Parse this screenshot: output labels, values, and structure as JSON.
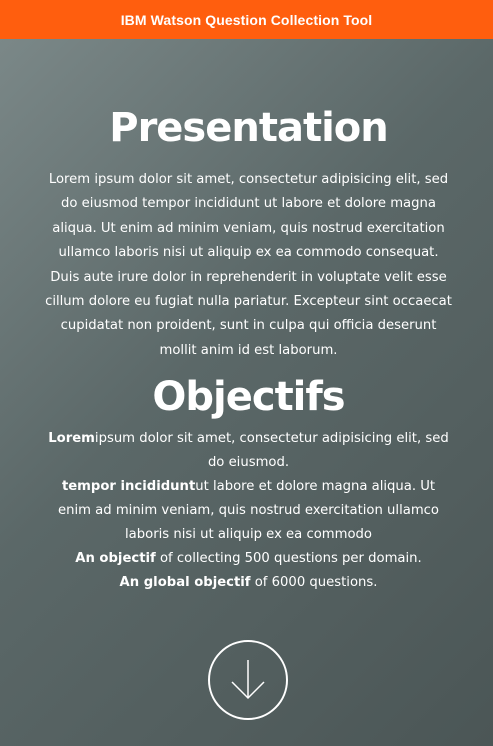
{
  "header": {
    "title": "IBM Watson Question Collection Tool"
  },
  "presentation": {
    "heading": "Presentation",
    "text": "Lorem ipsum dolor sit amet, consectetur adipisicing elit, sed do eiusmod tempor incididunt ut labore et dolore magna aliqua. Ut enim ad minim veniam, quis nostrud exercitation ullamco laboris nisi ut aliquip ex ea commodo consequat. Duis aute irure dolor in reprehenderit in voluptate velit esse cillum dolore eu fugiat nulla pariatur. Excepteur sint occaecat cupidatat non proident, sunt in culpa qui officia deserunt mollit anim id est laborum."
  },
  "objectifs": {
    "heading": "Objectifs",
    "line1_bold": "Lorem",
    "line1_text": "ipsum dolor sit amet, consectetur adipisicing elit, sed do eiusmod.",
    "line2_bold": "tempor incididunt",
    "line2_text": "ut labore et dolore magna aliqua. Ut enim ad minim veniam, quis nostrud exercitation ullamco laboris nisi ut aliquip ex ea commodo",
    "line3_bold": "An objectif",
    "line3_text": " of collecting 500 questions per domain.",
    "line4_bold": "An global objectif",
    "line4_text": " of 6000 questions."
  },
  "scroll_button": {
    "icon": "arrow-down-icon"
  },
  "colors": {
    "header_bg": "#ff5e0e",
    "text": "#ffffff"
  }
}
